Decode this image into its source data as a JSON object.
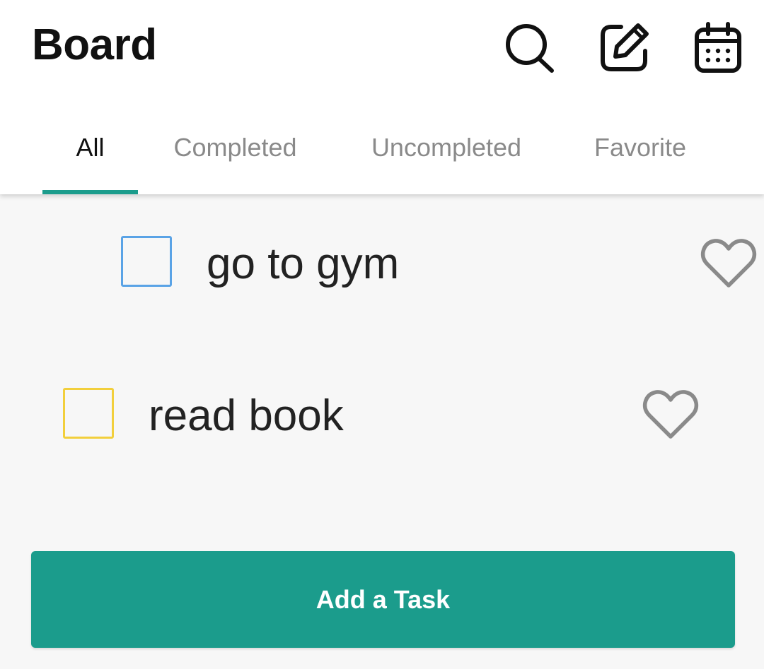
{
  "header": {
    "title": "Board",
    "icons": [
      "search-icon",
      "edit-icon",
      "calendar-icon"
    ]
  },
  "tabs": [
    {
      "label": "All",
      "active": true
    },
    {
      "label": "Completed",
      "active": false
    },
    {
      "label": "Uncompleted",
      "active": false
    },
    {
      "label": "Favorite",
      "active": false
    }
  ],
  "tasks": [
    {
      "text": "go to gym",
      "checkbox_color": "#5aa3e6",
      "checked": false,
      "favorite": false
    },
    {
      "text": "read book",
      "checkbox_color": "#f2cf3c",
      "checked": false,
      "favorite": false
    }
  ],
  "add_button": {
    "label": "Add a Task"
  },
  "colors": {
    "accent": "#1b9c8c",
    "heart_outline": "#8a8a8a",
    "inactive_tab": "#8a8a8a"
  }
}
